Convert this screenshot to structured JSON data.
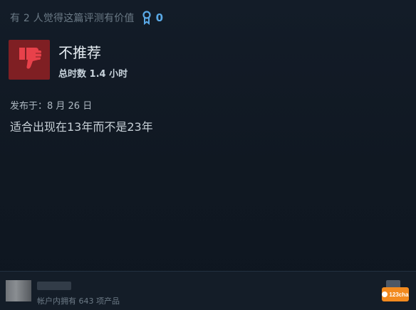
{
  "review": {
    "helpful_text": "有 2 人觉得这篇评测有价值",
    "award_count": "0",
    "verdict": "不推荐",
    "hours": "总时数 1.4 小时",
    "posted": "发布于：8 月 26 日",
    "body": "适合出现在13年而不是23年"
  },
  "footer": {
    "products": "帐户内拥有 643 项产品"
  },
  "watermark": {
    "text": "123cha"
  },
  "colors": {
    "background": "#0f1722",
    "thumb_box": "#7f1f23",
    "thumb_icon": "#e8414a",
    "award": "#5aa9e6"
  },
  "icons": {
    "award": "award-ribbon-icon",
    "thumb": "thumbs-down-icon"
  }
}
